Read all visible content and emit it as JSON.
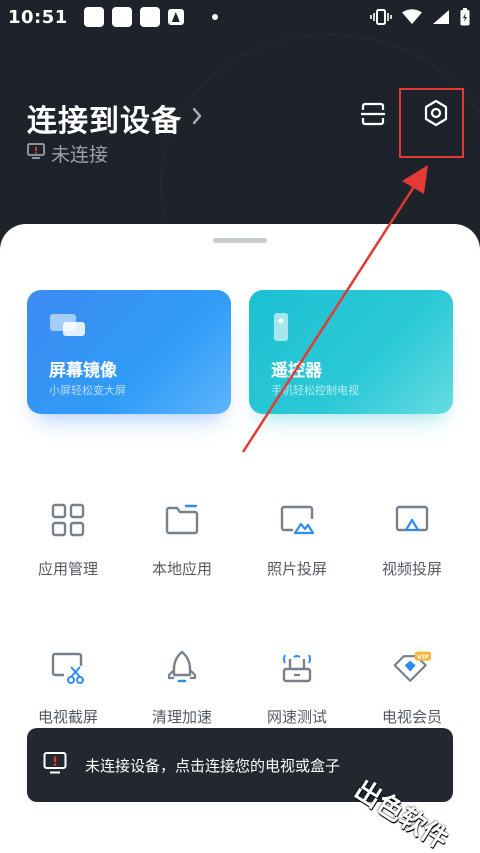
{
  "status_bar": {
    "time": "10:51"
  },
  "header": {
    "title": "连接到设备",
    "connection_status": "未连接"
  },
  "cards": [
    {
      "title": "屏幕镜像",
      "subtitle": "小屏轻松变大屏",
      "icon": "screen-mirror-icon"
    },
    {
      "title": "遥控器",
      "subtitle": "手机轻松控制电视",
      "icon": "remote-icon"
    }
  ],
  "grid": [
    {
      "label": "应用管理",
      "icon": "app-grid-icon"
    },
    {
      "label": "本地应用",
      "icon": "folder-icon"
    },
    {
      "label": "照片投屏",
      "icon": "photo-cast-icon"
    },
    {
      "label": "视频投屏",
      "icon": "video-cast-icon"
    },
    {
      "label": "电视截屏",
      "icon": "screenshot-icon"
    },
    {
      "label": "清理加速",
      "icon": "rocket-icon"
    },
    {
      "label": "网速测试",
      "icon": "router-icon"
    },
    {
      "label": "电视会员",
      "icon": "vip-diamond-icon",
      "badge": "VIP"
    }
  ],
  "toast": {
    "text": "未连接设备，点击连接您的电视或盒子"
  },
  "watermark": {
    "text": "出色软件"
  },
  "colors": {
    "header_bg": "#1e222b",
    "mirror_card": "#3e8af2",
    "remote_card": "#1cc0d2",
    "icon_gray": "#7a808a",
    "accent_blue": "#2f8cf5",
    "highlight_red": "#e53935"
  }
}
